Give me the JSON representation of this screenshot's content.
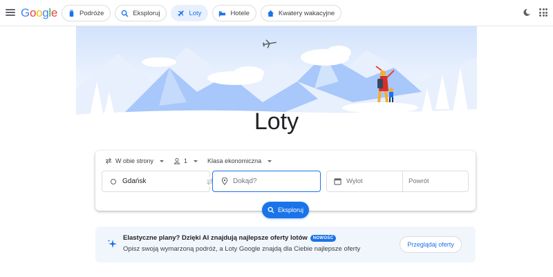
{
  "header": {
    "logo": {
      "g1": "G",
      "o1": "o",
      "o2": "o",
      "g2": "g",
      "l": "l",
      "e": "e"
    },
    "nav": [
      {
        "label": "Podróże",
        "icon": "travel-bag-icon",
        "active": false
      },
      {
        "label": "Eksploruj",
        "icon": "explore-search-icon",
        "active": false
      },
      {
        "label": "Loty",
        "icon": "plane-icon",
        "active": true
      },
      {
        "label": "Hotele",
        "icon": "bed-icon",
        "active": false
      },
      {
        "label": "Kwatery wakacyjne",
        "icon": "house-icon",
        "active": false
      }
    ],
    "theme_icon": "dark-mode-icon",
    "apps_icon": "apps-grid-icon"
  },
  "page": {
    "title": "Loty"
  },
  "search": {
    "trip_type": "W obie strony",
    "passengers": "1",
    "cabin_class": "Klasa ekonomiczna",
    "from_value": "Gdańsk",
    "to_placeholder": "Dokąd?",
    "departure_placeholder": "Wylot",
    "return_placeholder": "Powrót",
    "explore_label": "Eksploruj"
  },
  "banner": {
    "title": "Elastyczne plany? Dzięki AI znajdują najlepsze oferty lotów",
    "badge": "NOWOŚĆ",
    "description": "Opisz swoją wymarzoną podróż, a Loty Google znajdą dla Ciebie najlepsze oferty",
    "button_label": "Przeglądaj oferty"
  },
  "colors": {
    "accent": "#1a73e8",
    "hero_blue": "#a8c7fa",
    "banner_bg": "#f1f6fd"
  }
}
